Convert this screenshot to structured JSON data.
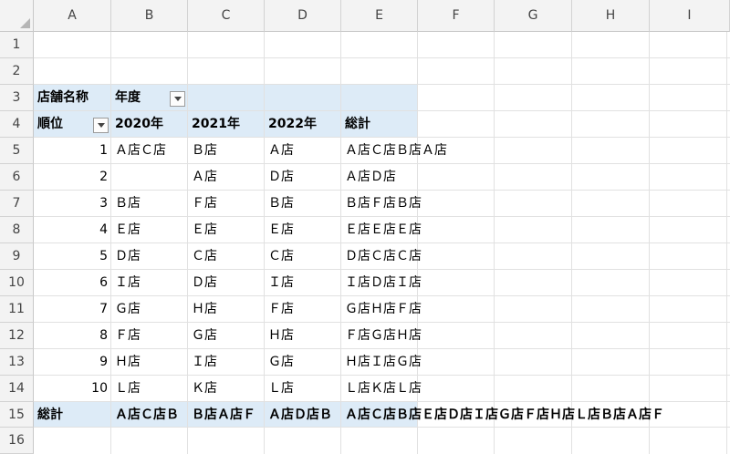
{
  "columns": [
    "A",
    "B",
    "C",
    "D",
    "E",
    "F",
    "G",
    "H",
    "I"
  ],
  "rows": [
    "1",
    "2",
    "3",
    "4",
    "5",
    "6",
    "7",
    "8",
    "9",
    "10",
    "11",
    "12",
    "13",
    "14",
    "15",
    "16"
  ],
  "pivot": {
    "row3": {
      "a": "店舗名称",
      "b": "年度"
    },
    "row4": {
      "a": "順位",
      "b": "2020年",
      "c": "2021年",
      "d": "2022年",
      "e": "総計"
    },
    "data": [
      {
        "rank": "1",
        "y2020": "Ａ店Ｃ店",
        "y2021": "Ｂ店",
        "y2022": "Ａ店",
        "total": "Ａ店Ｃ店Ｂ店Ａ店"
      },
      {
        "rank": "2",
        "y2020": "",
        "y2021": "Ａ店",
        "y2022": "Ｄ店",
        "total": "Ａ店Ｄ店"
      },
      {
        "rank": "3",
        "y2020": "Ｂ店",
        "y2021": "Ｆ店",
        "y2022": "Ｂ店",
        "total": "Ｂ店Ｆ店Ｂ店"
      },
      {
        "rank": "4",
        "y2020": "Ｅ店",
        "y2021": "Ｅ店",
        "y2022": "Ｅ店",
        "total": "Ｅ店Ｅ店Ｅ店"
      },
      {
        "rank": "5",
        "y2020": "Ｄ店",
        "y2021": "Ｃ店",
        "y2022": "Ｃ店",
        "total": "Ｄ店Ｃ店Ｃ店"
      },
      {
        "rank": "6",
        "y2020": "Ｉ店",
        "y2021": "Ｄ店",
        "y2022": "Ｉ店",
        "total": "Ｉ店Ｄ店Ｉ店"
      },
      {
        "rank": "7",
        "y2020": "Ｇ店",
        "y2021": "Ｈ店",
        "y2022": "Ｆ店",
        "total": "Ｇ店Ｈ店Ｆ店"
      },
      {
        "rank": "8",
        "y2020": "Ｆ店",
        "y2021": "Ｇ店",
        "y2022": "Ｈ店",
        "total": "Ｆ店Ｇ店Ｈ店"
      },
      {
        "rank": "9",
        "y2020": "Ｈ店",
        "y2021": "Ｉ店",
        "y2022": "Ｇ店",
        "total": "Ｈ店Ｉ店Ｇ店"
      },
      {
        "rank": "10",
        "y2020": "Ｌ店",
        "y2021": "Ｋ店",
        "y2022": "Ｌ店",
        "total": "Ｌ店Ｋ店Ｌ店"
      }
    ],
    "grand_total": {
      "label": "総計",
      "b": "Ａ店Ｃ店Ｂ",
      "c": "Ｂ店Ａ店Ｆ",
      "d": "Ａ店Ｄ店Ｂ",
      "e": "Ａ店Ｃ店Ｂ店Ｅ店Ｄ店Ｉ店Ｇ店Ｆ店Ｈ店Ｌ店Ｂ店Ａ店Ｆ"
    }
  },
  "colors": {
    "pivot_band": "#ddebf7",
    "gridline": "#e1e1e1",
    "header_bg": "#f3f3f3"
  }
}
